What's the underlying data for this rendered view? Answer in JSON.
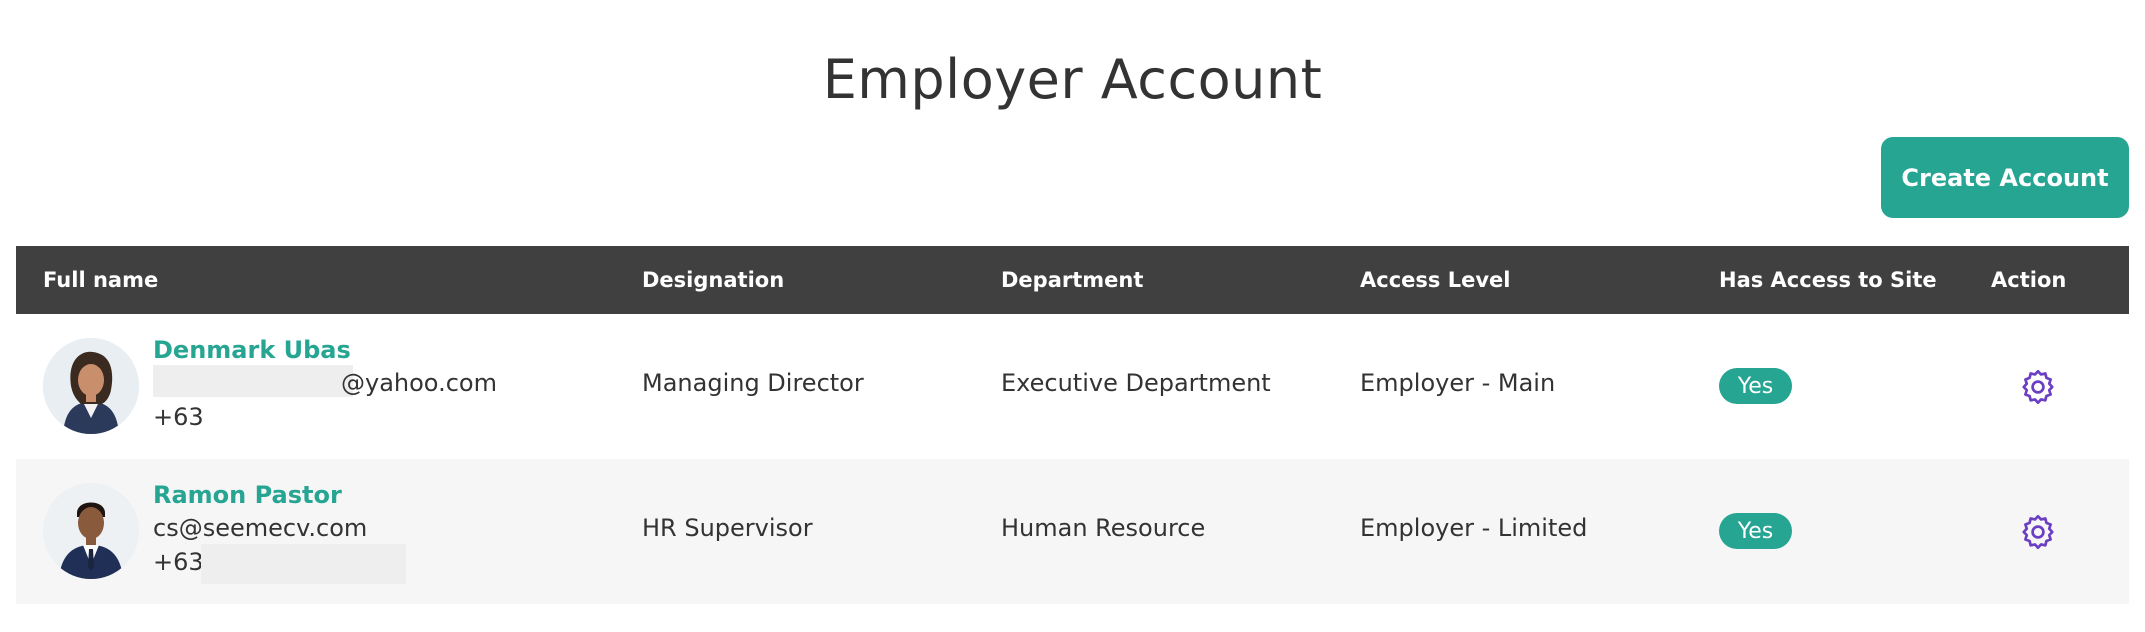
{
  "page": {
    "title": "Employer Account"
  },
  "toolbar": {
    "create_label": "Create Account"
  },
  "table": {
    "headers": {
      "full_name": "Full name",
      "designation": "Designation",
      "department": "Department",
      "access_level": "Access Level",
      "has_access": "Has Access to Site",
      "action": "Action"
    },
    "rows": [
      {
        "name": "Denmark Ubas",
        "email": "@yahoo.com",
        "phone": "+63",
        "designation": "Managing Director",
        "department": "Executive Department",
        "access_level": "Employer - Main",
        "has_access": "Yes",
        "action_icon": "gear-icon"
      },
      {
        "name": "Ramon Pastor",
        "email": "cs@seemecv.com",
        "phone": "+63",
        "designation": "HR Supervisor",
        "department": "Human Resource",
        "access_level": "Employer - Limited",
        "has_access": "Yes",
        "action_icon": "gear-icon"
      }
    ]
  },
  "colors": {
    "accent": "#27a593",
    "header_bg": "#404040",
    "icon_purple": "#6b3fc4",
    "alt_row": "#f6f6f6"
  }
}
